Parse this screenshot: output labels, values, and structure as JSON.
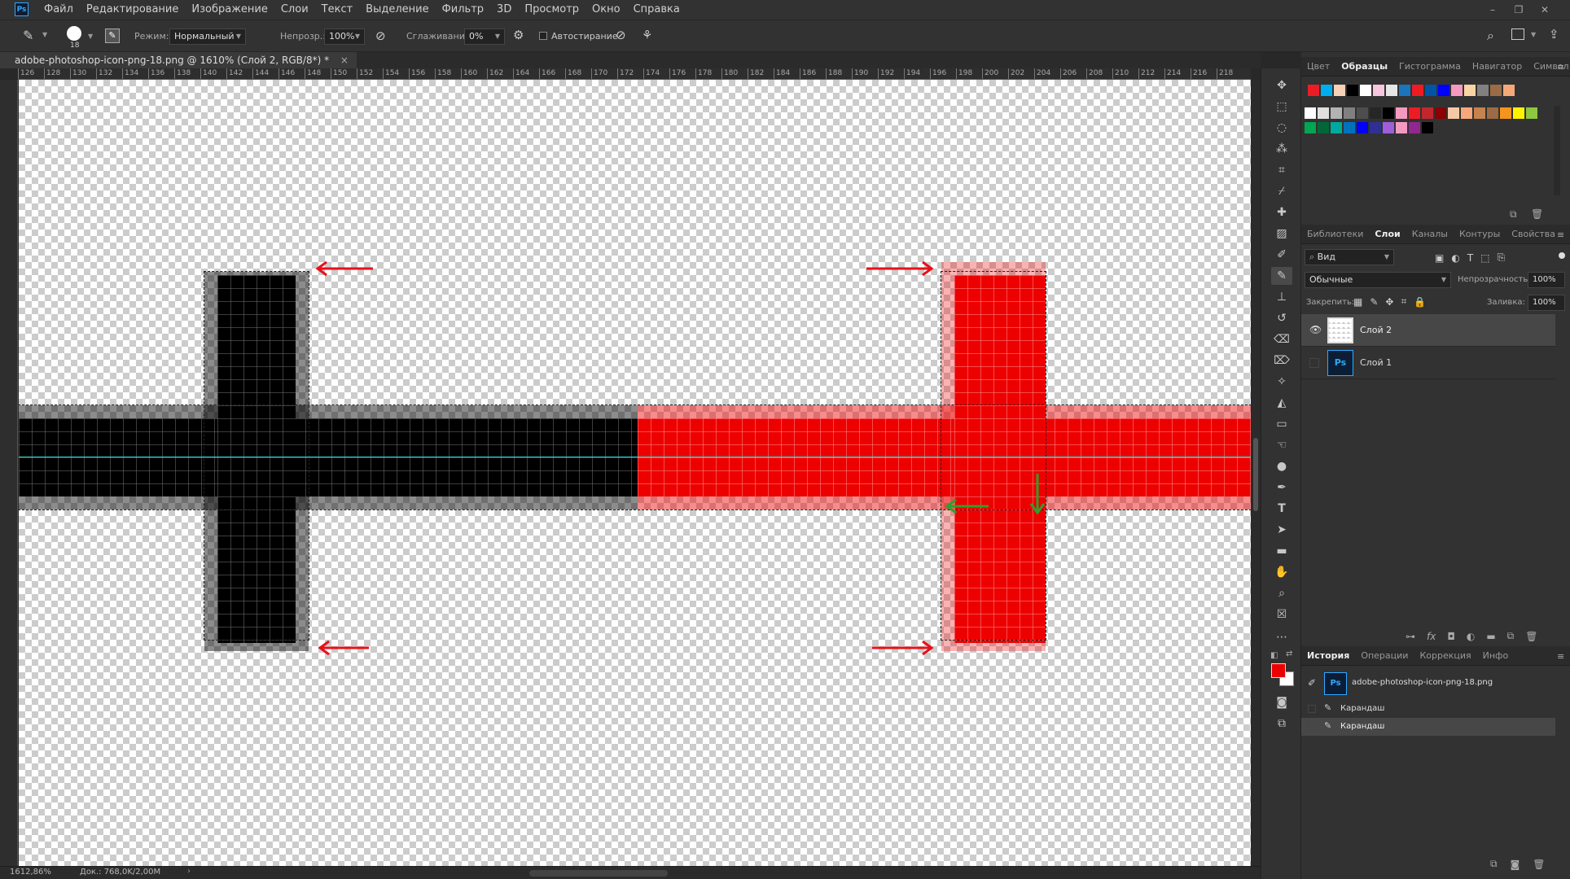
{
  "menu": [
    "Файл",
    "Редактирование",
    "Изображение",
    "Слои",
    "Текст",
    "Выделение",
    "Фильтр",
    "3D",
    "Просмотр",
    "Окно",
    "Справка"
  ],
  "app_logo": "Ps",
  "options": {
    "brush_size": "18",
    "mode_label": "Режим:",
    "mode_value": "Нормальный",
    "opacity_label": "Непрозр.:",
    "opacity_value": "100%",
    "smoothing_label": "Сглаживание:",
    "smoothing_value": "0%",
    "auto_erase_label": "Автостирание"
  },
  "document": {
    "tab_title": "adobe-photoshop-icon-png-18.png @ 1610% (Слой 2, RGB/8*) *",
    "close": "×"
  },
  "ruler_ticks": [
    "126",
    "128",
    "130",
    "132",
    "134",
    "136",
    "138",
    "140",
    "142",
    "144",
    "146",
    "148",
    "150",
    "152",
    "154",
    "156",
    "158",
    "160",
    "162",
    "164",
    "166",
    "168",
    "170",
    "172",
    "174",
    "176",
    "178",
    "180",
    "182",
    "184",
    "186",
    "188",
    "190",
    "192",
    "194",
    "196",
    "198",
    "200",
    "202",
    "204",
    "206",
    "208",
    "210",
    "212",
    "214",
    "216",
    "218"
  ],
  "status": {
    "zoom": "1612,86%",
    "doc": "Док.: 768,0K/2,00M"
  },
  "colors": {
    "red": "#ed0000",
    "black": "#000000",
    "arrow_red": "#e8101a",
    "arrow_green": "#2ca02c",
    "guide": "#3ad9d9"
  },
  "swatch_panel": {
    "tabs": [
      "Цвет",
      "Образцы",
      "Гистограмма",
      "Навигатор",
      "Символ"
    ],
    "active": 1,
    "row1": [
      "#ed1c24",
      "#00aeef",
      "#f7d1b5",
      "#000000",
      "#ffffff",
      "#f5c6dd",
      "#e6e6e6",
      "#1b75bc",
      "#ed1c24",
      "#0054a6",
      "#0000ff",
      "#f49ac1",
      "#f9d5a6",
      "#808080",
      "#9b6b45",
      "#f5a97b"
    ],
    "row2": [
      "#ffffff",
      "#e0e0e0",
      "#b3b3b3",
      "#808080",
      "#4d4d4d",
      "#262626",
      "#000000",
      "#f49ac1",
      "#ed1c24",
      "#c1272d",
      "#8b0000",
      "#f5c9a7",
      "#f5a97b",
      "#c7834f",
      "#9b6b45",
      "#f7941d",
      "#fff200",
      "#8dc63f"
    ],
    "row3": [
      "#00a651",
      "#006837",
      "#00a99d",
      "#0072bc",
      "#0000ff",
      "#2e3192",
      "#9e5fd8",
      "#f49ac1",
      "#92278f",
      "#000000"
    ]
  },
  "layers_panel": {
    "tabs": [
      "Библиотеки",
      "Слои",
      "Каналы",
      "Контуры",
      "Свойства"
    ],
    "active": 1,
    "search": "Вид",
    "blend": "Обычные",
    "opacity_label": "Непрозрачность:",
    "opacity_value": "100%",
    "lock_label": "Закрепить:",
    "fill_label": "Заливка:",
    "fill_value": "100%",
    "layers": [
      {
        "name": "Слой 2",
        "visible": true,
        "selected": true
      },
      {
        "name": "Слой 1",
        "visible": false,
        "selected": false
      }
    ]
  },
  "history_panel": {
    "tabs": [
      "История",
      "Операции",
      "Коррекция",
      "Инфо"
    ],
    "active": 0,
    "snapshot": "adobe-photoshop-icon-png-18.png",
    "items": [
      "Карандаш",
      "Карандаш"
    ]
  }
}
